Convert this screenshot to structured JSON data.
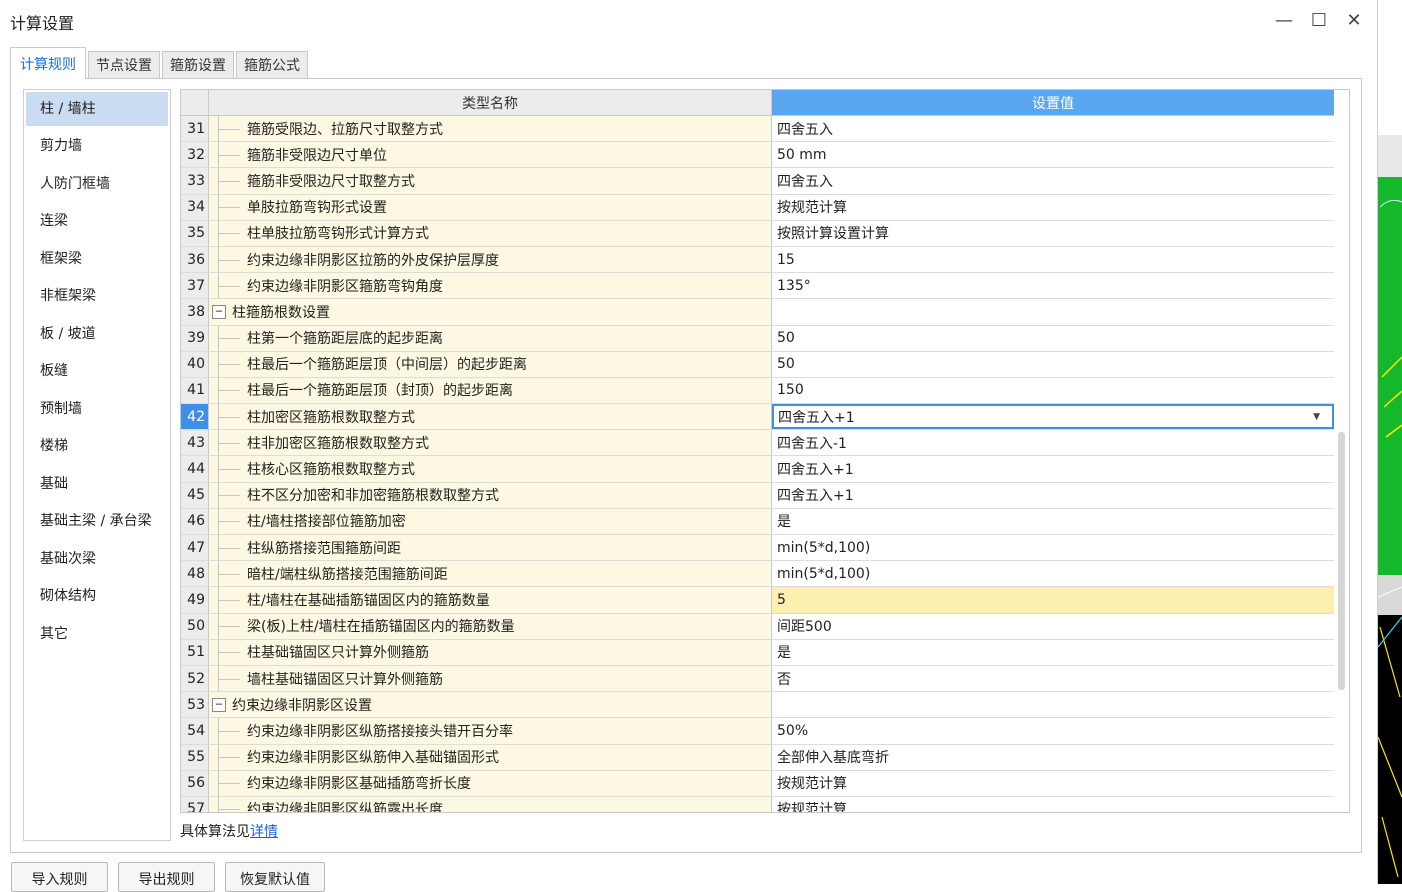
{
  "window": {
    "title": "计算设置",
    "minimize_glyph": "—",
    "maximize_glyph": "☐",
    "close_glyph": "✕"
  },
  "tabs": [
    {
      "label": "计算规则",
      "active": true
    },
    {
      "label": "节点设置",
      "active": false
    },
    {
      "label": "箍筋设置",
      "active": false
    },
    {
      "label": "箍筋公式",
      "active": false
    }
  ],
  "sidebar": {
    "items": [
      {
        "label": "柱 / 墙柱",
        "active": true
      },
      {
        "label": "剪力墙"
      },
      {
        "label": "人防门框墙"
      },
      {
        "label": "连梁"
      },
      {
        "label": "框架梁"
      },
      {
        "label": "非框架梁"
      },
      {
        "label": "板 / 坡道"
      },
      {
        "label": "板缝"
      },
      {
        "label": "预制墙"
      },
      {
        "label": "楼梯"
      },
      {
        "label": "基础"
      },
      {
        "label": "基础主梁 / 承台梁"
      },
      {
        "label": "基础次梁"
      },
      {
        "label": "砌体结构"
      },
      {
        "label": "其它"
      }
    ]
  },
  "grid": {
    "header": {
      "type_name": "类型名称",
      "setting_value": "设置值"
    },
    "rows": [
      {
        "num": "31",
        "name": "箍筋受限边、拉筋尺寸取整方式",
        "value": "四舍五入"
      },
      {
        "num": "32",
        "name": "箍筋非受限边尺寸单位",
        "value": "50 mm"
      },
      {
        "num": "33",
        "name": "箍筋非受限边尺寸取整方式",
        "value": "四舍五入"
      },
      {
        "num": "34",
        "name": "单肢拉筋弯钩形式设置",
        "value": "按规范计算"
      },
      {
        "num": "35",
        "name": "柱单肢拉筋弯钩形式计算方式",
        "value": "按照计算设置计算"
      },
      {
        "num": "36",
        "name": "约束边缘非阴影区拉筋的外皮保护层厚度",
        "value": "15"
      },
      {
        "num": "37",
        "name": "约束边缘非阴影区箍筋弯钩角度",
        "value": "135°"
      },
      {
        "num": "38",
        "name": "柱箍筋根数设置",
        "value": "",
        "group": true,
        "toggle": "−"
      },
      {
        "num": "39",
        "name": "柱第一个箍筋距层底的起步距离",
        "value": "50"
      },
      {
        "num": "40",
        "name": "柱最后一个箍筋距层顶（中间层）的起步距离",
        "value": "50"
      },
      {
        "num": "41",
        "name": "柱最后一个箍筋距层顶（封顶）的起步距离",
        "value": "150"
      },
      {
        "num": "42",
        "name": "柱加密区箍筋根数取整方式",
        "value": "四舍五入+1",
        "selected": true,
        "dropdown_arrow": "▼"
      },
      {
        "num": "43",
        "name": "柱非加密区箍筋根数取整方式",
        "value": "四舍五入-1"
      },
      {
        "num": "44",
        "name": "柱核心区箍筋根数取整方式",
        "value": "四舍五入+1"
      },
      {
        "num": "45",
        "name": "柱不区分加密和非加密箍筋根数取整方式",
        "value": "四舍五入+1"
      },
      {
        "num": "46",
        "name": "柱/墙柱搭接部位箍筋加密",
        "value": "是"
      },
      {
        "num": "47",
        "name": "柱纵筋搭接范围箍筋间距",
        "value": "min(5*d,100)"
      },
      {
        "num": "48",
        "name": "暗柱/端柱纵筋搭接范围箍筋间距",
        "value": "min(5*d,100)"
      },
      {
        "num": "49",
        "name": "柱/墙柱在基础插筋锚固区内的箍筋数量",
        "value": "5",
        "highlight": true
      },
      {
        "num": "50",
        "name": "梁(板)上柱/墙柱在插筋锚固区内的箍筋数量",
        "value": "间距500"
      },
      {
        "num": "51",
        "name": "柱基础锚固区只计算外侧箍筋",
        "value": "是"
      },
      {
        "num": "52",
        "name": "墙柱基础锚固区只计算外侧箍筋",
        "value": "否"
      },
      {
        "num": "53",
        "name": "约束边缘非阴影区设置",
        "value": "",
        "group": true,
        "toggle": "−"
      },
      {
        "num": "54",
        "name": "约束边缘非阴影区纵筋搭接接头错开百分率",
        "value": "50%"
      },
      {
        "num": "55",
        "name": "约束边缘非阴影区纵筋伸入基础锚固形式",
        "value": "全部伸入基底弯折"
      },
      {
        "num": "56",
        "name": "约束边缘非阴影区基础插筋弯折长度",
        "value": "按规范计算"
      },
      {
        "num": "57",
        "name": "约束边缘非阴影区纵筋露出长度",
        "value": "按规范计算"
      }
    ]
  },
  "detail": {
    "prefix": "具体算法见",
    "link": "详情"
  },
  "buttons": {
    "import": "导入规则",
    "export": "导出规则",
    "restore": "恢复默认值"
  }
}
